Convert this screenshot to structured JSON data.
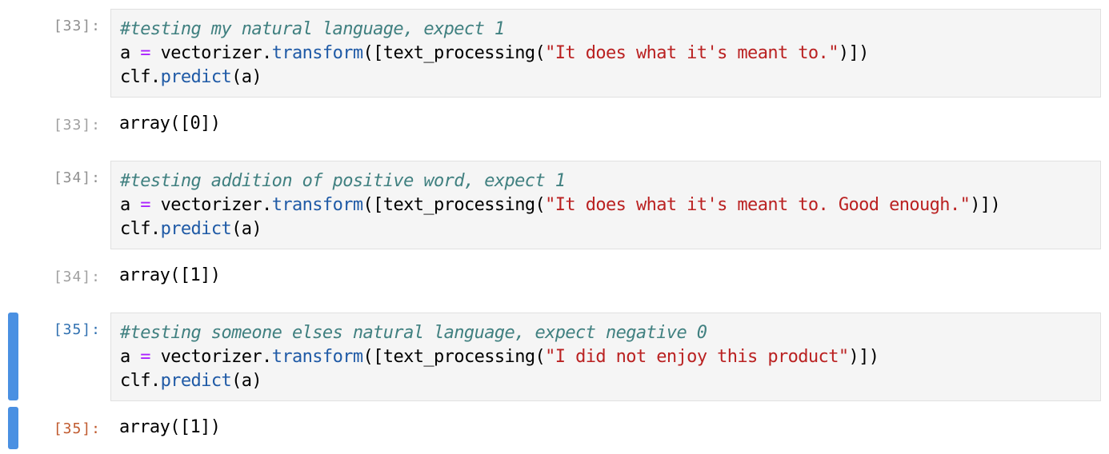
{
  "colors": {
    "active_bar": "#4a90e2",
    "comment": "#408080",
    "operator": "#aa22ff",
    "attribute": "#1f5aa6",
    "string": "#ba2121",
    "input_prompt_active": "#3070b0",
    "output_prompt_active": "#c05a2e"
  },
  "cells": [
    {
      "in_prompt": "[33]:",
      "out_prompt": "[33]:",
      "code": {
        "comment": "#testing my natural language, expect 1",
        "line2": {
          "var": "a",
          "eq": " = ",
          "obj": "vectorizer.",
          "method": "transform",
          "open": "([text_processing(",
          "string": "\"It does what it's meant to.\"",
          "close": ")])"
        },
        "line3": {
          "obj": "clf.",
          "method": "predict",
          "args": "(a)"
        }
      },
      "output": "array([0])"
    },
    {
      "in_prompt": "[34]:",
      "out_prompt": "[34]:",
      "code": {
        "comment": "#testing addition of positive word, expect 1",
        "line2": {
          "var": "a",
          "eq": " = ",
          "obj": "vectorizer.",
          "method": "transform",
          "open": "([text_processing(",
          "string": "\"It does what it's meant to. Good enough.\"",
          "close": ")])"
        },
        "line3": {
          "obj": "clf.",
          "method": "predict",
          "args": "(a)"
        }
      },
      "output": "array([1])"
    },
    {
      "in_prompt": "[35]:",
      "out_prompt": "[35]:",
      "code": {
        "comment": "#testing someone elses natural language, expect negative 0",
        "line2": {
          "var": "a",
          "eq": " = ",
          "obj": "vectorizer.",
          "method": "transform",
          "open": "([text_processing(",
          "string": "\"I did not enjoy this product\"",
          "close": ")])"
        },
        "line3": {
          "obj": "clf.",
          "method": "predict",
          "args": "(a)"
        }
      },
      "output": "array([1])"
    }
  ]
}
